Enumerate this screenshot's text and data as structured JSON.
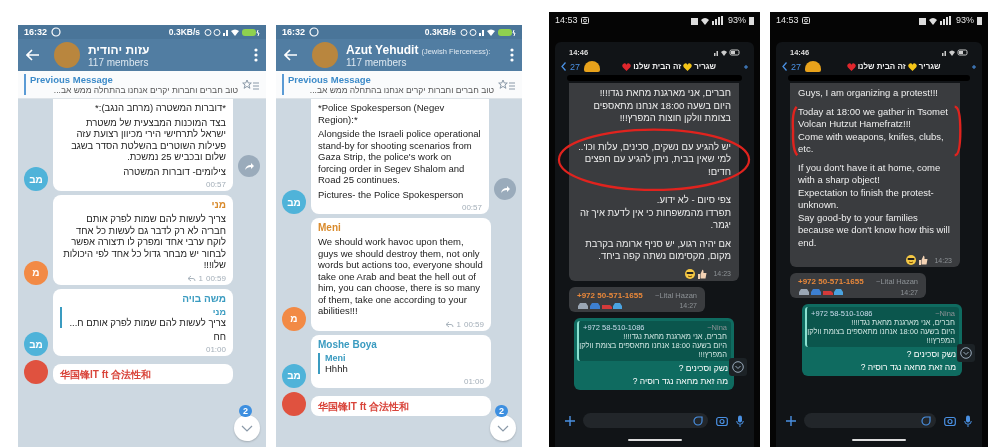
{
  "telegram_original": {
    "kind": "telegram",
    "status_time": "16:32",
    "status_speed": "0.3KB/s",
    "title": "עזות יהודית",
    "subtitle": "117 members",
    "pinned_label": "Previous Message",
    "pinned_text": "טוב חברים וחברות יקרים אנחנו בהתחלה ממש אב...",
    "unread": "2",
    "messages": [
      {
        "avatar": {
          "initials": "מב",
          "color": "#4fb3d9"
        },
        "paragraphs": [
          "*דוברות המשטרה (מרחב הנגב):*",
          "בצד המוכנות המבצעית של משטרת ישראל לתרחישי הירי מכיוון רצועת עזה פעילות השוטרים בהשלטת הסדר בשגב שלום ובכביש 25 נמשכת.",
          "צילומים- דוברות המשטרה"
        ],
        "time": "00:57",
        "forward": true
      },
      {
        "avatar": {
          "initials": "מ",
          "color": "#f28a45"
        },
        "sender": {
          "name": "מני",
          "color": "#d98a2b"
        },
        "paragraphs": [
          "צריך לעשות להם שמות לפרק אותם חבר'ה לא רק לדבר גם לעשות כל אחד לוקח ערבי אחד ומפרק לו ת'צורה אפשר לבחור יש מבחר גדול כל אחד לפי היכולות שלו!!!"
        ],
        "replies": "1",
        "time": "00:59",
        "forward": false
      },
      {
        "avatar": {
          "initials": "מב",
          "color": "#4fb3d9"
        },
        "sender": {
          "name": "משה בויה",
          "color": "#3a9bc0"
        },
        "quote_sender": "מני",
        "quote_text": "צריך לעשות להם שמות לפרק אותם ח...",
        "paragraphs": [
          "חח"
        ],
        "time": "01:00",
        "forward": false
      },
      {
        "avatar": {
          "color": "#e0523f"
        },
        "sender": {
          "name": "华国锋IT ft 合法性和",
          "color": "#d9443a"
        },
        "forward": false
      }
    ]
  },
  "telegram_translated": {
    "kind": "telegram",
    "status_time": "16:32",
    "status_speed": "0.3KB/s",
    "title": "Azut Yehudit",
    "title_note": "(Jewish Fierceness):",
    "subtitle": "117 members",
    "pinned_label": "Previous Message",
    "pinned_text": "טוב חברים וחברות יקרים אנחנו בהתחלה ממש אב...",
    "unread": "2",
    "messages": [
      {
        "avatar": {
          "initials": "מב",
          "color": "#4fb3d9"
        },
        "paragraphs": [
          "*Police Spokesperson (Negev Region):*",
          "Alongside the Israeli police operational stand-by for shooting scenarios from Gaza Strip, the police's work on forcing order in Segev Shalom and Road 25 continues.",
          "Pictures- the Police Spokesperson"
        ],
        "time": "00:57",
        "forward": true
      },
      {
        "avatar": {
          "initials": "מ",
          "color": "#f28a45"
        },
        "sender": {
          "name": "Meni",
          "color": "#d98a2b"
        },
        "paragraphs": [
          "We should work havoc upon them, guys we should destroy them, not only words but actions too, everyone should take one Arab and beat the hell out of him, you can choose, there is so many of them, take one according to your abilities!!!"
        ],
        "replies": "1",
        "time": "00:59",
        "forward": false
      },
      {
        "avatar": {
          "initials": "מב",
          "color": "#4fb3d9"
        },
        "sender": {
          "name": "Moshe Boya",
          "color": "#3a9bc0"
        },
        "quote_sender": "Meni",
        "quote_text": "Hhhh",
        "time": "01:00",
        "forward": false
      },
      {
        "avatar": {
          "color": "#e0523f"
        },
        "sender": {
          "name": "华国锋IT ft 合法性和",
          "color": "#d9443a"
        },
        "forward": false
      }
    ]
  },
  "whatsapp_original": {
    "kind": "whatsapp",
    "outer_time": "14:53",
    "battery": "93%",
    "inner_time": "14:46",
    "back_count": "27",
    "title_parts": [
      {
        "text": "שגריר",
        "heart": {
          "color": "#f5c518"
        }
      },
      {
        "text": "זה הבית שלנו",
        "heart": {
          "color": "#e0262c"
        }
      }
    ],
    "message": {
      "annotation": {
        "kind": "ellipse"
      },
      "time": "14:23",
      "blocks": [
        {
          "marked": false,
          "lines": [
            "חברים, אני מארגנת מחאת נגד!!!!",
            "היום בשעה 18:00 אנחנו מתאספים",
            "בצומת וולקן חוצות המפרץ!!!"
          ]
        },
        {
          "marked": true,
          "lines": [
            "יש להגיע עם נשקים, סכינים, עלות וכו'..",
            "למי שאין בבית, ניתן להגיע עם חפצים חדים!"
          ]
        },
        {
          "marked": false,
          "lines": [
            "צפי סיום - לא ידוע.",
            "תפרדו מהמשפחות כי אין לדעת איך זה יגמר."
          ]
        },
        {
          "marked": false,
          "lines": [
            "אם יהיה רגוע, יש סניף ארומה בקרבת מקום, מקסימום נשתה קפה ביחד."
          ]
        }
      ]
    },
    "message2": {
      "phone": "+972 50-571-1655",
      "name": "~Lital Hazan",
      "time": "14:27"
    },
    "reply": {
      "quote_phone": "+972 58-510-1086",
      "quote_name": "~Nina",
      "quote_lines": [
        "חברים, אני מארגנת מחאת נגד!!!!",
        "היום בשעה 18:00 אנחנו מתאספים בצומת וולקן",
        "המפרץ!!!"
      ],
      "lines": [
        "נשק וסכינים ?",
        "מה זאת מחאה נגד רוסיה ?"
      ]
    }
  },
  "whatsapp_translated": {
    "kind": "whatsapp",
    "outer_time": "14:53",
    "battery": "93%",
    "inner_time": "14:46",
    "back_count": "27",
    "title_parts": [
      {
        "text": "שגריר",
        "heart": {
          "color": "#f5c518"
        }
      },
      {
        "text": "זה הבית שלנו",
        "heart": {
          "color": "#e0262c"
        }
      }
    ],
    "message": {
      "annotation": {
        "kind": "brackets"
      },
      "time": "14:23",
      "blocks": [
        {
          "marked": false,
          "lines": [
            "Guys, I am organizing a protest!!!"
          ]
        },
        {
          "marked": true,
          "lines": [
            "Today at 18:00 we gather in Tsomet Volcan Hutzut Hamefratz!!!",
            "Come with weapons, knifes, clubs, etc."
          ]
        },
        {
          "marked": false,
          "lines": [
            "If you don't have it at home, come with a sharp object!",
            "Expectation to finish the protest- unknown.",
            "Say good-by to your families because we don't know how this will end."
          ]
        }
      ]
    },
    "message2": {
      "phone": "+972 50-571-1655",
      "name": "~Lital Hazan",
      "time": "14:27"
    },
    "reply": {
      "quote_phone": "+972 58-510-1086",
      "quote_name": "~Nina",
      "quote_lines": [
        "חברים, אני מארגנת מחאת נגד!!!!",
        "היום בשעה 18:00 אנחנו מתאספים בצומת וולקן",
        "המפרץ!!!"
      ],
      "lines": [
        "נשק וסכינים ?",
        "מה זאת מחאה נגד רוסיה ?"
      ]
    }
  }
}
